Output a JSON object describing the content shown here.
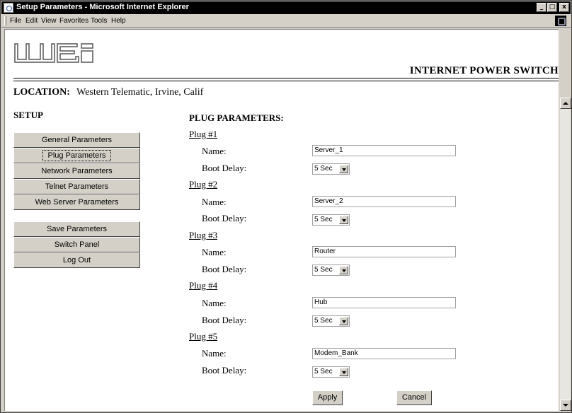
{
  "window": {
    "title": "Setup Parameters - Microsoft Internet Explorer",
    "buttons": {
      "minimize": "_",
      "maximize": "□",
      "close": "x"
    }
  },
  "menubar": {
    "items": [
      "File",
      "Edit",
      "View",
      "Favorites",
      "Tools",
      "Help"
    ]
  },
  "header": {
    "logo_text": "wti",
    "title": "INTERNET POWER SWITCH"
  },
  "location": {
    "label": "LOCATION:",
    "value": "Western Telematic, Irvine, Calif"
  },
  "sidebar": {
    "heading": "SETUP",
    "setup_items": [
      {
        "label": "General Parameters"
      },
      {
        "label": "Plug Parameters",
        "selected": true
      },
      {
        "label": "Network Parameters"
      },
      {
        "label": "Telnet Parameters"
      },
      {
        "label": "Web Server Parameters"
      }
    ],
    "action_items": [
      {
        "label": "Save Parameters"
      },
      {
        "label": "Switch Panel"
      },
      {
        "label": "Log Out"
      }
    ]
  },
  "main": {
    "heading": "PLUG PARAMETERS:",
    "name_label": "Name:",
    "boot_delay_label": "Boot Delay:",
    "plugs": [
      {
        "title": "Plug #1",
        "name": "Server_1",
        "boot_delay": "5 Sec"
      },
      {
        "title": "Plug #2",
        "name": "Server_2",
        "boot_delay": "5 Sec"
      },
      {
        "title": "Plug #3",
        "name": "Router",
        "boot_delay": "5 Sec"
      },
      {
        "title": "Plug #4",
        "name": "Hub",
        "boot_delay": "5 Sec"
      },
      {
        "title": "Plug #5",
        "name": "Modem_Bank",
        "boot_delay": "5 Sec"
      }
    ],
    "apply_label": "Apply",
    "cancel_label": "Cancel"
  }
}
